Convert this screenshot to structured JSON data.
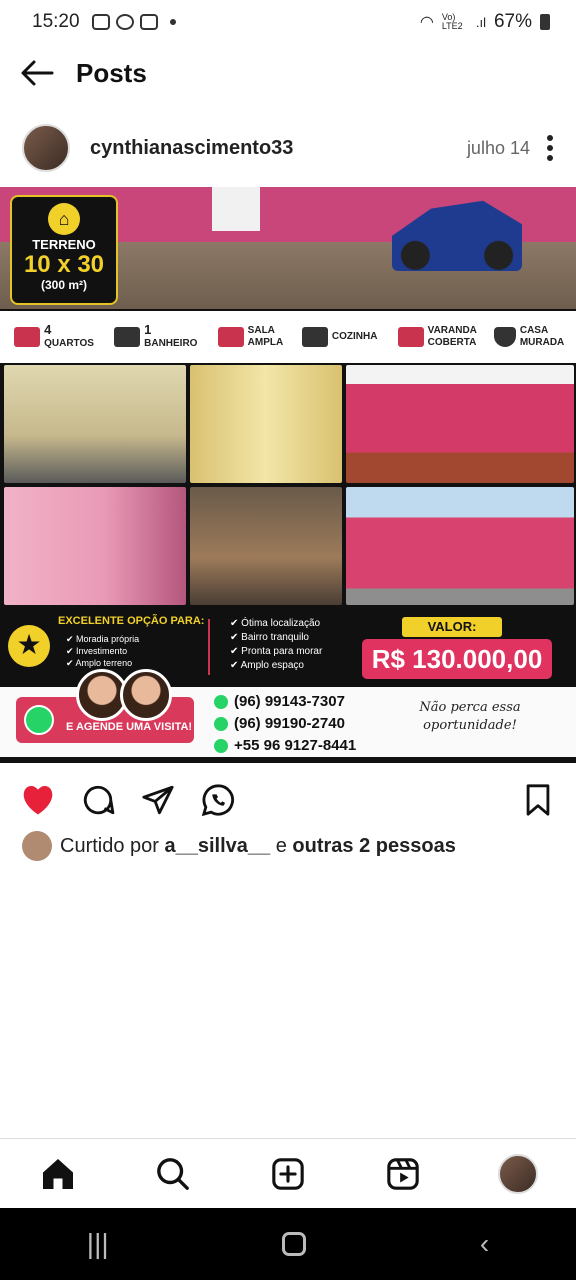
{
  "status_bar": {
    "time": "15:20",
    "signal_text": "Vo) LTE2",
    "battery": "67%"
  },
  "header": {
    "title": "Posts",
    "back_icon": "arrow-left-icon"
  },
  "post_header": {
    "username": "cynthianascimento33",
    "date": "julho 14",
    "menu_icon": "more-vertical-icon"
  },
  "post_image": {
    "terreno": {
      "label": "TERRENO",
      "size": "10 x 30",
      "area": "(300 m²)"
    },
    "features": [
      {
        "number": "4",
        "label": "QUARTOS"
      },
      {
        "number": "1",
        "label": "BANHEIRO"
      },
      {
        "number": "",
        "label": "SALA AMPLA"
      },
      {
        "number": "",
        "label": "COZINHA"
      },
      {
        "number": "",
        "label": "VARANDA COBERTA"
      },
      {
        "number": "",
        "label": "CASA MURADA"
      }
    ],
    "excelente_title": "EXCELENTE OPÇÃO PARA:",
    "excelente_items": [
      "Moradia própria",
      "Investimento",
      "Amplo terreno"
    ],
    "benefits": [
      "Ótima localização",
      "Bairro tranquilo",
      "Pronta para morar",
      "Amplo espaço"
    ],
    "valor_label": "VALOR:",
    "valor": "R$ 130.000,00",
    "cta": "E AGENDE UMA VISITA!",
    "phones": [
      "(96) 99143-7307",
      "(96) 99190-2740",
      "+55 96 9127-8441"
    ],
    "nao_perca": "Não perca essa oportunidade!"
  },
  "likes": {
    "prefix": "Curtido por",
    "user": "a__sillva__",
    "middle": "e",
    "others": "outras 2 pessoas"
  },
  "colors": {
    "like": "#e8213b",
    "accent_pink": "#d93a5c",
    "gold": "#f2d02a"
  }
}
